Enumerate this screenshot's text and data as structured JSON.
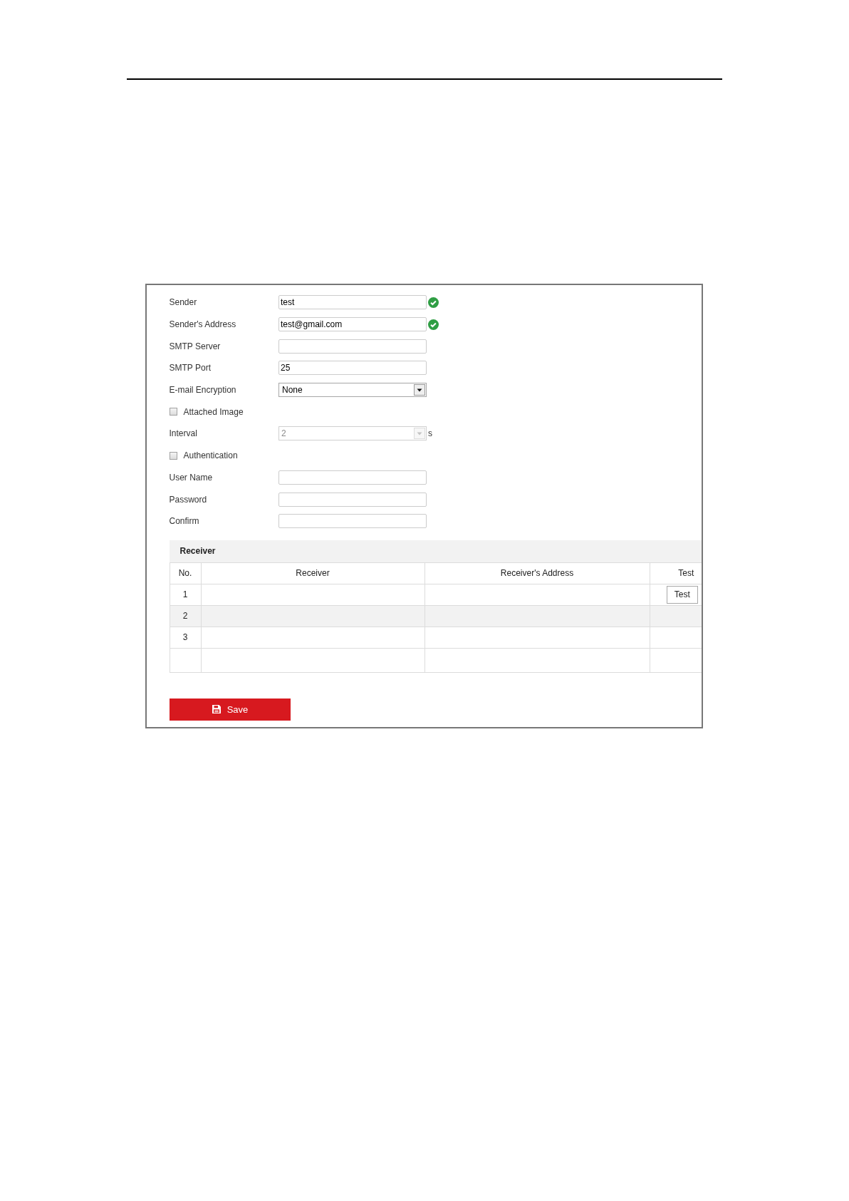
{
  "form": {
    "fields": [
      {
        "kind": "text",
        "label": "Sender",
        "value": "test",
        "valid": true
      },
      {
        "kind": "text",
        "label": "Sender's Address",
        "value": "test@gmail.com",
        "valid": true
      },
      {
        "kind": "text",
        "label": "SMTP Server"
      },
      {
        "kind": "text",
        "label": "SMTP Port",
        "value": "25"
      },
      {
        "kind": "select",
        "label": "E-mail Encryption",
        "value": "None",
        "disabled": false
      },
      {
        "kind": "checkbox",
        "label": "Attached Image",
        "checked": false
      },
      {
        "kind": "select",
        "label": "Interval",
        "value": "2",
        "disabled": true,
        "unit": "s"
      },
      {
        "kind": "checkbox",
        "label": "Authentication",
        "checked": false
      },
      {
        "kind": "text",
        "label": "User Name"
      },
      {
        "kind": "password",
        "label": "Password"
      },
      {
        "kind": "password",
        "label": "Confirm"
      }
    ]
  },
  "receiver": {
    "title": "Receiver",
    "columns": [
      "No.",
      "Receiver",
      "Receiver's Address",
      "Test"
    ],
    "rows": [
      {
        "kind": "entry",
        "no": "1",
        "test_button": "Test"
      },
      {
        "kind": "entry",
        "no": "2"
      },
      {
        "kind": "entry",
        "no": "3"
      },
      {
        "kind": "blank"
      }
    ]
  },
  "save_button": {
    "label": "Save"
  }
}
